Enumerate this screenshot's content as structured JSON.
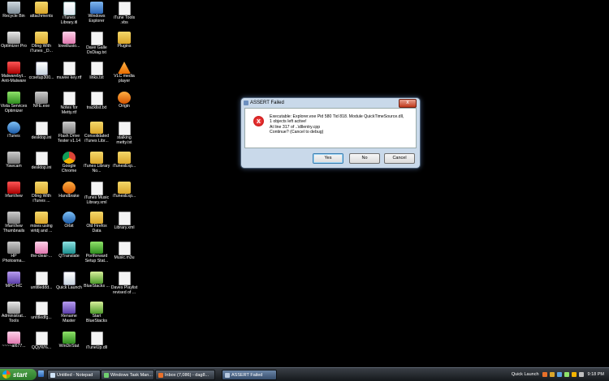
{
  "desktop": {
    "icons": [
      {
        "label": "Recycle Bin",
        "icon": "recycle-bin-icon"
      },
      {
        "label": "attachments",
        "icon": "folder-icon"
      },
      {
        "label": "iTunes Library.itl",
        "icon": "itl-file-icon"
      },
      {
        "label": "Windows Explorer",
        "icon": "explorer-icon"
      },
      {
        "label": "iTune Tools .vbs",
        "icon": "script-icon"
      },
      {
        "label": "Optimizer Pro",
        "icon": "tools-icon"
      },
      {
        "label": "DIing With iTunes _D...",
        "icon": "folder-icon"
      },
      {
        "label": "loveillusio...",
        "icon": "image-icon"
      },
      {
        "label": "Dave Galle DxDiag.txt",
        "icon": "text-file-icon"
      },
      {
        "label": "Plugins",
        "icon": "folder-icon"
      },
      {
        "label": "Malwarebyt... Anti-Malware",
        "icon": "malwarebytes-icon"
      },
      {
        "label": "ccsetup300...",
        "icon": "installer-icon"
      },
      {
        "label": "muvee key.rtf",
        "icon": "text-file-icon"
      },
      {
        "label": "links.txt",
        "icon": "text-file-icon"
      },
      {
        "label": "VLC media player",
        "icon": "vlc-icon"
      },
      {
        "label": "Vista Services Optimizer",
        "icon": "services-icon"
      },
      {
        "label": "NFE.exe",
        "icon": "app-icon"
      },
      {
        "label": "Notes for Metty.rtf",
        "icon": "text-file-icon"
      },
      {
        "label": "tracklist.txt",
        "icon": "text-file-icon"
      },
      {
        "label": "Origin",
        "icon": "origin-icon"
      },
      {
        "label": "iTunes",
        "icon": "itunes-icon"
      },
      {
        "label": "desktop.ini",
        "icon": "settings-file-icon"
      },
      {
        "label": "Flash Drive Tester v1.14",
        "icon": "usb-icon"
      },
      {
        "label": "Consolidated iTunes Libr...",
        "icon": "folder-icon"
      },
      {
        "label": "stalking metty.txt",
        "icon": "text-file-icon"
      },
      {
        "label": "Yawcam",
        "icon": "webcam-icon"
      },
      {
        "label": "desktop.ini",
        "icon": "settings-file-icon"
      },
      {
        "label": "Google Chrome",
        "icon": "chrome-icon"
      },
      {
        "label": "iTunes Library No...",
        "icon": "folder-icon"
      },
      {
        "label": "iTunesExp...",
        "icon": "package-icon"
      },
      {
        "label": "IrfanView",
        "icon": "irfanview-icon"
      },
      {
        "label": "DIing With iTunes ...",
        "icon": "folder-icon"
      },
      {
        "label": "Handbrake",
        "icon": "handbrake-icon"
      },
      {
        "label": "iTunes Music Library.xml",
        "icon": "xml-file-icon"
      },
      {
        "label": "iTunesExp...",
        "icon": "package-icon"
      },
      {
        "label": "IrfanView Thumbnails",
        "icon": "irfanview-thumbnails-icon"
      },
      {
        "label": "mixes using virtdj and ...",
        "icon": "folder-icon"
      },
      {
        "label": "Orbit",
        "icon": "orbit-icon"
      },
      {
        "label": "Old Firefox Data",
        "icon": "folder-icon"
      },
      {
        "label": "Library.xml",
        "icon": "xml-file-icon"
      },
      {
        "label": "HP Photosma...",
        "icon": "hp-icon"
      },
      {
        "label": "the-clear-...",
        "icon": "image-icon"
      },
      {
        "label": "QTranslate",
        "icon": "translate-icon"
      },
      {
        "label": "Portforward Setup Stat...",
        "icon": "network-icon"
      },
      {
        "label": "Music.m3u",
        "icon": "playlist-icon"
      },
      {
        "label": "MPC-HC",
        "icon": "mpc-icon"
      },
      {
        "label": "untitleddd...",
        "icon": "text-file-icon"
      },
      {
        "label": "Quick Launch",
        "icon": "shortcut-icon"
      },
      {
        "label": "BlueStacks ...",
        "icon": "bluestacks-icon"
      },
      {
        "label": "Daves Playlist revised of ...",
        "icon": "playlist-icon"
      },
      {
        "label": "Administrat... Tools",
        "icon": "admin-tools-icon"
      },
      {
        "label": "untitledfg...",
        "icon": "text-file-icon"
      },
      {
        "label": "Rename Master",
        "icon": "rename-icon"
      },
      {
        "label": "Start BlueStacks",
        "icon": "bluestacks-icon"
      },
      {
        "label": "",
        "icon": ""
      },
      {
        "label": "~~~~al677...",
        "icon": "image-icon"
      },
      {
        "label": "QQy%%...",
        "icon": "text-file-icon"
      },
      {
        "label": "WinDirStat",
        "icon": "windirstat-icon"
      },
      {
        "label": "iTuneUp.dll",
        "icon": "dll-file-icon"
      },
      {
        "label": "",
        "icon": ""
      }
    ]
  },
  "dialog": {
    "title": "ASSERT Failed",
    "close_symbol": "x",
    "error_symbol": "x",
    "message_lines": [
      "Executable: Explorer.exe  Pid 580  Tid 818. Module QuickTimeSource.dll,",
      "1 objects left active!",
      "At line 317 of ..\\dllentry.cpp",
      "Continue? (Cancel to debug)"
    ],
    "buttons": {
      "yes": "Yes",
      "no": "No",
      "cancel": "Cancel"
    }
  },
  "taskbar": {
    "start_label": "start",
    "tasks": [
      {
        "label": "Untitled - Notepad"
      },
      {
        "label": "Windows Task Man..."
      },
      {
        "label": "Inbox (7,086) - dag8..."
      },
      {
        "label": "ASSERT Failed"
      }
    ],
    "quick_launch_label": "Quick Launch",
    "clock": "9:18 PM"
  }
}
